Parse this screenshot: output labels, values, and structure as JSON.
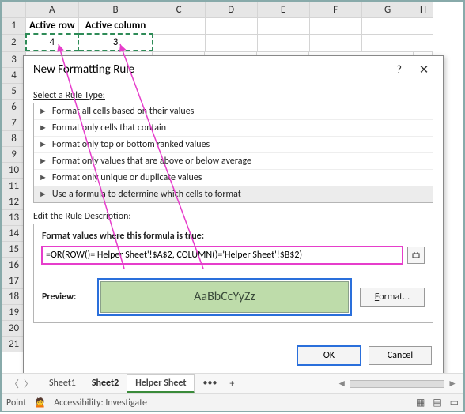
{
  "grid": {
    "colHeaders": [
      "A",
      "B",
      "C",
      "D",
      "E",
      "F",
      "G",
      "H"
    ],
    "rowCount": 21,
    "a1": "Active row",
    "b1": "Active column",
    "a2": "4",
    "b2": "3"
  },
  "dialog": {
    "title": "New Formatting Rule",
    "helpGlyph": "?",
    "closeGlyph": "✕",
    "selectRule": "Select a Rule Type:",
    "rules": [
      "Format all cells based on their values",
      "Format only cells that contain",
      "Format only top or bottom ranked values",
      "Format only values that are above or below average",
      "Format only unique or duplicate values",
      "Use a formula to determine which cells to format"
    ],
    "editDesc": "Edit the Rule Description:",
    "formulaLabel": "Format values where this formula is true:",
    "formulaValue": "=OR(ROW()='Helper Sheet'!$A$2, COLUMN()='Helper Sheet'!$B$2)",
    "previewLabel": "Preview:",
    "previewSample": "AaBbCcYyZz",
    "formatBtn": "Format...",
    "ok": "OK",
    "cancel": "Cancel"
  },
  "tabs": {
    "sheet1": "Sheet1",
    "sheet2": "Sheet2",
    "helper": "Helper Sheet",
    "more": "•••",
    "add": "+"
  },
  "status": {
    "mode": "Point",
    "access": "Accessibility: Investigate"
  }
}
